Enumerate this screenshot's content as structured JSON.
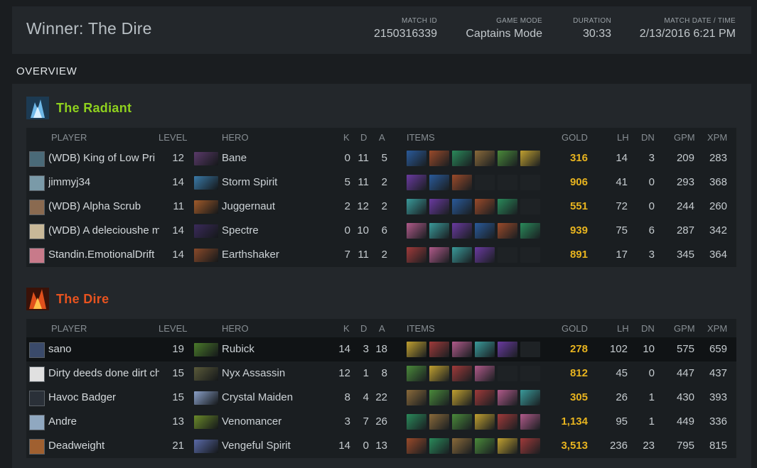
{
  "header": {
    "winner": "Winner: The Dire",
    "match_id_label": "MATCH ID",
    "match_id": "2150316339",
    "game_mode_label": "GAME MODE",
    "game_mode": "Captains Mode",
    "duration_label": "DURATION",
    "duration": "30:33",
    "date_label": "MATCH DATE / TIME",
    "date": "2/13/2016 6:21 PM"
  },
  "overview_label": "OVERVIEW",
  "columns": {
    "player": "PLAYER",
    "level": "LEVEL",
    "hero": "HERO",
    "k": "K",
    "d": "D",
    "a": "A",
    "items": "ITEMS",
    "gold": "GOLD",
    "lh": "LH",
    "dn": "DN",
    "gpm": "GPM",
    "xpm": "XPM"
  },
  "colors": {
    "radiant": "#8fd11e",
    "dire": "#e8531f",
    "gold": "#e8b41f"
  },
  "radiant": {
    "name": "The Radiant",
    "players": [
      {
        "player": "(WDB) King of Low Pri",
        "level": "12",
        "hero": "Bane",
        "k": "0",
        "d": "11",
        "a": "5",
        "gold": "316",
        "lh": "14",
        "dn": "3",
        "gpm": "209",
        "xpm": "283"
      },
      {
        "player": "jimmyj34",
        "level": "14",
        "hero": "Storm Spirit",
        "k": "5",
        "d": "11",
        "a": "2",
        "gold": "906",
        "lh": "41",
        "dn": "0",
        "gpm": "293",
        "xpm": "368"
      },
      {
        "player": "(WDB) Alpha Scrub",
        "level": "11",
        "hero": "Juggernaut",
        "k": "2",
        "d": "12",
        "a": "2",
        "gold": "551",
        "lh": "72",
        "dn": "0",
        "gpm": "244",
        "xpm": "260"
      },
      {
        "player": "(WDB) A delecioushe mo",
        "level": "14",
        "hero": "Spectre",
        "k": "0",
        "d": "10",
        "a": "6",
        "gold": "939",
        "lh": "75",
        "dn": "6",
        "gpm": "287",
        "xpm": "342"
      },
      {
        "player": "Standin.EmotionalDrift",
        "level": "14",
        "hero": "Earthshaker",
        "k": "7",
        "d": "11",
        "a": "2",
        "gold": "891",
        "lh": "17",
        "dn": "3",
        "gpm": "345",
        "xpm": "364"
      }
    ]
  },
  "dire": {
    "name": "The Dire",
    "players": [
      {
        "player": "sano",
        "level": "19",
        "hero": "Rubick",
        "k": "14",
        "d": "3",
        "a": "18",
        "gold": "278",
        "lh": "102",
        "dn": "10",
        "gpm": "575",
        "xpm": "659"
      },
      {
        "player": "Dirty deeds done dirt cheap",
        "level": "15",
        "hero": "Nyx Assassin",
        "k": "12",
        "d": "1",
        "a": "8",
        "gold": "812",
        "lh": "45",
        "dn": "0",
        "gpm": "447",
        "xpm": "437"
      },
      {
        "player": "Havoc Badger",
        "level": "15",
        "hero": "Crystal Maiden",
        "k": "8",
        "d": "4",
        "a": "22",
        "gold": "305",
        "lh": "26",
        "dn": "1",
        "gpm": "430",
        "xpm": "393"
      },
      {
        "player": "Andre",
        "level": "13",
        "hero": "Venomancer",
        "k": "3",
        "d": "7",
        "a": "26",
        "gold": "1,134",
        "lh": "95",
        "dn": "1",
        "gpm": "449",
        "xpm": "336"
      },
      {
        "player": "Deadweight",
        "level": "21",
        "hero": "Vengeful Spirit",
        "k": "14",
        "d": "0",
        "a": "13",
        "gold": "3,513",
        "lh": "236",
        "dn": "23",
        "gpm": "795",
        "xpm": "815"
      }
    ]
  }
}
